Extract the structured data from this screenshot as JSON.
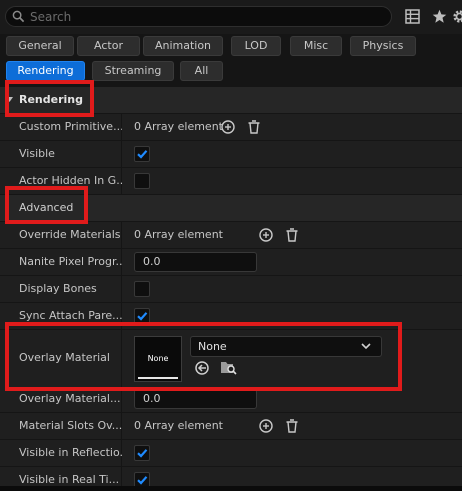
{
  "search": {
    "placeholder": "Search",
    "value": ""
  },
  "toolbar_icons": [
    "table-view-icon",
    "favorite-star-icon",
    "settings-gear-icon"
  ],
  "filter_tabs": [
    {
      "label": "General",
      "active": false
    },
    {
      "label": "Actor",
      "active": false
    },
    {
      "label": "Animation",
      "active": false
    },
    {
      "label": "LOD",
      "active": false
    },
    {
      "label": "Misc",
      "active": false
    },
    {
      "label": "Physics",
      "active": false
    },
    {
      "label": "Rendering",
      "active": true
    },
    {
      "label": "Streaming",
      "active": false
    },
    {
      "label": "All",
      "active": false
    }
  ],
  "categories": {
    "rendering": "Rendering",
    "advanced": "Advanced"
  },
  "properties": {
    "custom_primitive": {
      "label": "Custom Primitive...",
      "value": "0 Array element"
    },
    "visible": {
      "label": "Visible",
      "checked": true
    },
    "actor_hidden": {
      "label": "Actor Hidden In G...",
      "checked": false
    },
    "override_materials": {
      "label": "Override Materials",
      "value": "0 Array element"
    },
    "nanite_pixel": {
      "label": "Nanite Pixel Progr...",
      "value": "0.0"
    },
    "display_bones": {
      "label": "Display Bones",
      "checked": false
    },
    "sync_attach": {
      "label": "Sync Attach Pare...",
      "checked": true
    },
    "overlay_material": {
      "label": "Overlay Material",
      "thumbnail_text": "None",
      "value": "None"
    },
    "overlay_material_max": {
      "label": "Overlay Material...",
      "value": "0.0"
    },
    "material_slots": {
      "label": "Material Slots Ov...",
      "value": "0 Array element"
    },
    "visible_reflection": {
      "label": "Visible in Reflectio...",
      "checked": true
    },
    "visible_realtime": {
      "label": "Visible in Real Ti...",
      "checked": true
    }
  },
  "colors": {
    "accent": "#0d6dd8",
    "highlight": "#e01b1b",
    "check": "#1f8bff"
  }
}
